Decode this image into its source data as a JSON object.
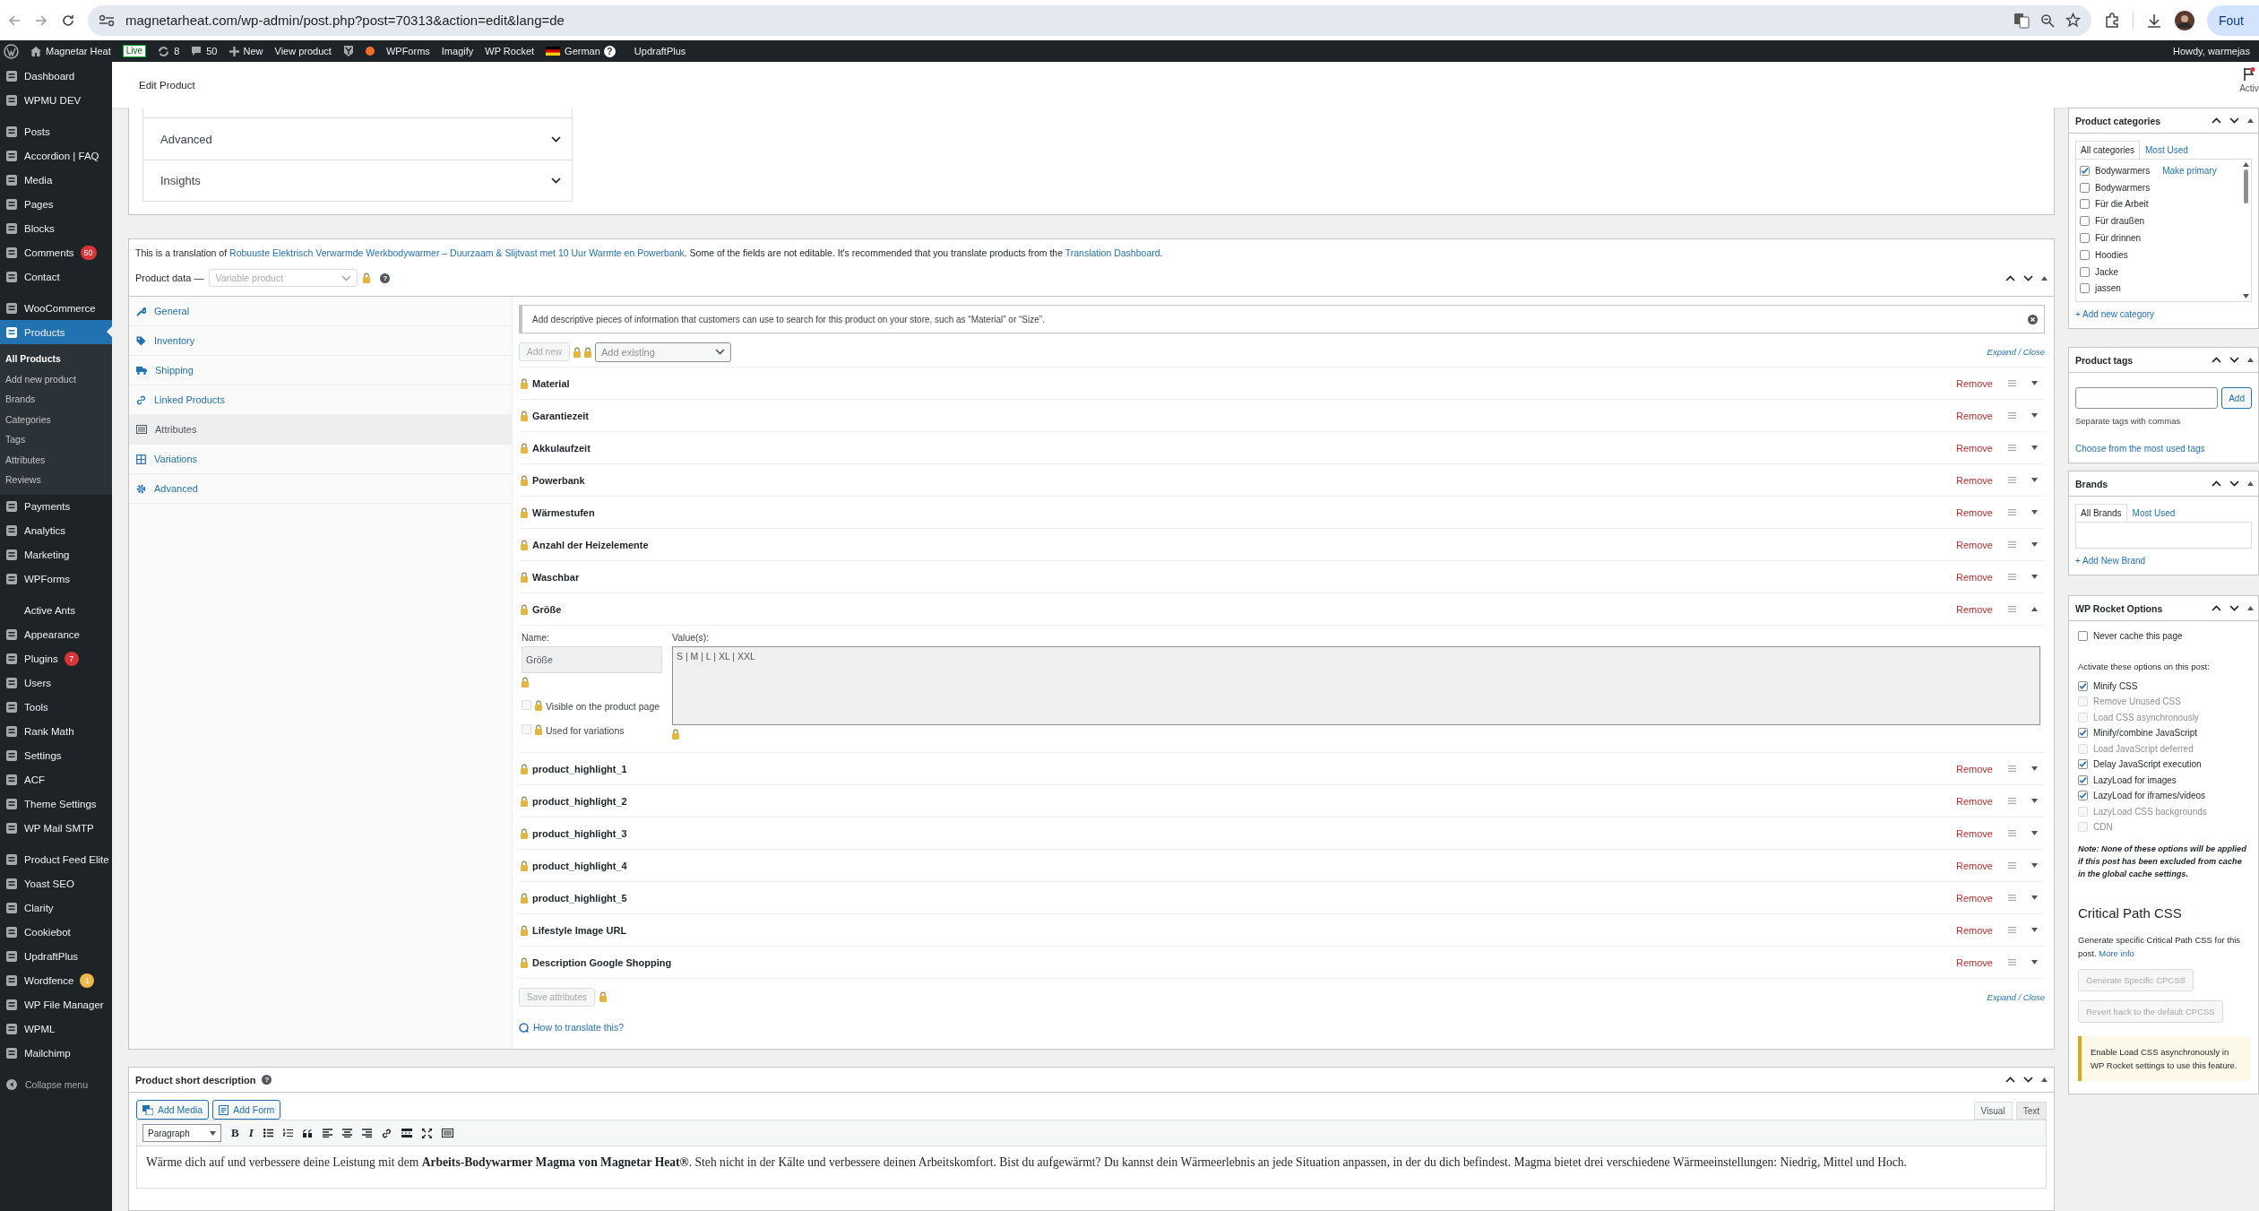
{
  "browser": {
    "url": "magnetarheat.com/wp-admin/post.php?post=70313&action=edit&lang=de",
    "profile_button": "Fout"
  },
  "admin_bar": {
    "site_name": "Magnetar Heat",
    "live_badge": "Live",
    "updates_count": "8",
    "comments_count": "50",
    "new_label": "New",
    "view_link": "View product",
    "plugin_links": [
      "WPForms",
      "Imagify",
      "WP Rocket"
    ],
    "language": "German",
    "language_help": "?",
    "updraft": "UpdraftPlus",
    "greeting": "Howdy, warmejas"
  },
  "page_header": {
    "title": "Edit Product",
    "activity": "Activ"
  },
  "sidebar": {
    "groups": [
      [
        {
          "label": "Dashboard",
          "icon": true,
          "selected": false
        },
        {
          "label": "WPMU DEV",
          "icon": true,
          "selected": false
        }
      ],
      [
        {
          "label": "Posts",
          "icon": true,
          "selected": false
        },
        {
          "label": "Accordion | FAQ",
          "icon": true,
          "selected": false
        },
        {
          "label": "Media",
          "icon": true,
          "selected": false
        },
        {
          "label": "Pages",
          "icon": true,
          "selected": false
        },
        {
          "label": "Blocks",
          "icon": true,
          "selected": false
        },
        {
          "label": "Comments",
          "icon": true,
          "selected": false,
          "badge": {
            "text": "50",
            "color": "#d63638"
          }
        },
        {
          "label": "Contact",
          "icon": true,
          "selected": false
        }
      ],
      [
        {
          "label": "WooCommerce",
          "icon": true,
          "selected": false
        },
        {
          "label": "Products",
          "icon": true,
          "selected": true,
          "children": [
            {
              "label": "All Products",
              "selected": true
            },
            {
              "label": "Add new product",
              "selected": false
            },
            {
              "label": "Brands",
              "selected": false
            },
            {
              "label": "Categories",
              "selected": false
            },
            {
              "label": "Tags",
              "selected": false
            },
            {
              "label": "Attributes",
              "selected": false
            },
            {
              "label": "Reviews",
              "selected": false
            }
          ]
        },
        {
          "label": "Payments",
          "icon": true,
          "selected": false
        },
        {
          "label": "Analytics",
          "icon": true,
          "selected": false
        },
        {
          "label": "Marketing",
          "icon": true,
          "selected": false
        },
        {
          "label": "WPForms",
          "icon": true,
          "selected": false
        }
      ],
      [
        {
          "label": "Active Ants",
          "icon": false,
          "selected": false
        },
        {
          "label": "Appearance",
          "icon": true,
          "selected": false
        },
        {
          "label": "Plugins",
          "icon": true,
          "selected": false,
          "badge": {
            "text": "7",
            "color": "#d63638"
          }
        },
        {
          "label": "Users",
          "icon": true,
          "selected": false
        },
        {
          "label": "Tools",
          "icon": true,
          "selected": false
        },
        {
          "label": "Rank Math",
          "icon": true,
          "selected": false
        },
        {
          "label": "Settings",
          "icon": true,
          "selected": false
        },
        {
          "label": "ACF",
          "icon": true,
          "selected": false
        },
        {
          "label": "Theme Settings",
          "icon": true,
          "selected": false
        },
        {
          "label": "WP Mail SMTP",
          "icon": true,
          "selected": false
        }
      ],
      [
        {
          "label": "Product Feed Elite",
          "icon": true,
          "selected": false
        },
        {
          "label": "Yoast SEO",
          "icon": true,
          "selected": false
        },
        {
          "label": "Clarity",
          "icon": true,
          "selected": false
        },
        {
          "label": "Cookiebot",
          "icon": true,
          "selected": false
        },
        {
          "label": "UpdraftPlus",
          "icon": true,
          "selected": false
        },
        {
          "label": "Wordfence",
          "icon": true,
          "selected": false,
          "badge": {
            "text": "1",
            "color": "#f0b849"
          }
        },
        {
          "label": "WP File Manager",
          "icon": true,
          "selected": false
        },
        {
          "label": "WPML",
          "icon": true,
          "selected": false
        },
        {
          "label": "Mailchimp",
          "icon": true,
          "selected": false
        }
      ]
    ],
    "collapse": "Collapse menu"
  },
  "accordion": [
    {
      "label": "Advanced",
      "expanded": false
    },
    {
      "label": "Insights",
      "expanded": false
    }
  ],
  "product_data": {
    "translation_note": {
      "before": "This is a translation of ",
      "link": "Robuuste Elektrisch Verwarmde Werkbodywarmer – Duurzaam & Slijtvast met 10 Uur Warmte en Powerbank",
      "middle": ". Some of the fields are not editable. It's recommended that you translate products from the ",
      "link2": "Translation Dashboard",
      "after": "."
    },
    "title": "Product data —",
    "product_type": "Variable product",
    "help": "?",
    "tabs": [
      {
        "label": "General",
        "selected": false
      },
      {
        "label": "Inventory",
        "selected": false
      },
      {
        "label": "Shipping",
        "selected": false
      },
      {
        "label": "Linked Products",
        "selected": false
      },
      {
        "label": "Attributes",
        "selected": true
      },
      {
        "label": "Variations",
        "selected": false
      },
      {
        "label": "Advanced",
        "selected": false
      }
    ],
    "notice": "Add descriptive pieces of information that customers can use to search for this product on your store, such as “Material” or “Size”.",
    "add_new": "Add new",
    "add_existing": "Add existing",
    "expand_close": "Expand / Close",
    "attributes": [
      {
        "name": "Material",
        "expanded": false,
        "remove": "Remove"
      },
      {
        "name": "Garantiezeit",
        "expanded": false,
        "remove": "Remove"
      },
      {
        "name": "Akkulaufzeit",
        "expanded": false,
        "remove": "Remove"
      },
      {
        "name": "Powerbank",
        "expanded": false,
        "remove": "Remove"
      },
      {
        "name": "Wärmestufen",
        "expanded": false,
        "remove": "Remove"
      },
      {
        "name": "Anzahl der Heizelemente",
        "expanded": false,
        "remove": "Remove"
      },
      {
        "name": "Waschbar",
        "expanded": false,
        "remove": "Remove"
      },
      {
        "name": "Größe",
        "expanded": true,
        "remove": "Remove",
        "name_label": "Name:",
        "name_value": "Größe",
        "values_label": "Value(s):",
        "values": "S | M | L | XL | XXL",
        "visible_label": "Visible on the product page",
        "visible": false,
        "variations_label": "Used for variations",
        "variations": false
      },
      {
        "name": "product_highlight_1",
        "expanded": false,
        "remove": "Remove"
      },
      {
        "name": "product_highlight_2",
        "expanded": false,
        "remove": "Remove"
      },
      {
        "name": "product_highlight_3",
        "expanded": false,
        "remove": "Remove"
      },
      {
        "name": "product_highlight_4",
        "expanded": false,
        "remove": "Remove"
      },
      {
        "name": "product_highlight_5",
        "expanded": false,
        "remove": "Remove"
      },
      {
        "name": "Lifestyle Image URL",
        "expanded": false,
        "remove": "Remove"
      },
      {
        "name": "Description Google Shopping",
        "expanded": false,
        "remove": "Remove"
      }
    ],
    "save": "Save attributes",
    "expand_close_bottom": "Expand / Close",
    "how_to": "How to translate this?"
  },
  "short_description": {
    "title": "Product short description",
    "help": "?",
    "add_media": "Add Media",
    "add_form": "Add Form",
    "modes": [
      {
        "label": "Visual",
        "selected": true
      },
      {
        "label": "Text",
        "selected": false
      }
    ],
    "format": "Paragraph",
    "bold": "B",
    "italic": "I",
    "content": "Wärme dich auf und verbessere deine Leistung mit dem **Arbeits-Bodywarmer Magma von Magnetar Heat®**. Steh nicht in der Kälte und verbessere deinen Arbeitskomfort. Bist du aufgewärmt? Du kannst dein Wärmeerlebnis an jede Situation anpassen, in der du dich befindest. Magma bietet drei verschiedene Wärmeeinstellungen: Niedrig, Mittel und Hoch."
  },
  "categories": {
    "title": "Product categories",
    "tabs": [
      {
        "label": "All categories",
        "selected": true
      },
      {
        "label": "Most Used",
        "selected": false
      }
    ],
    "items": [
      {
        "label": "Bodywarmers",
        "checked": true,
        "primary_link": "Make primary"
      },
      {
        "label": "Bodywarmers",
        "checked": false
      },
      {
        "label": "Für die Arbeit",
        "checked": false
      },
      {
        "label": "Für draußen",
        "checked": false
      },
      {
        "label": "Für drinnen",
        "checked": false
      },
      {
        "label": "Hoodies",
        "checked": false
      },
      {
        "label": "Jacke",
        "checked": false
      },
      {
        "label": "jassen",
        "checked": false
      }
    ],
    "add_link": "+ Add new category"
  },
  "tags": {
    "title": "Product tags",
    "add": "Add",
    "hint": "Separate tags with commas",
    "link": "Choose from the most used tags"
  },
  "brands": {
    "title": "Brands",
    "tabs": [
      {
        "label": "All Brands",
        "selected": true
      },
      {
        "label": "Most Used",
        "selected": false
      }
    ],
    "add_link": "+ Add New Brand"
  },
  "wp_rocket": {
    "title": "WP Rocket Options",
    "never_cache": {
      "label": "Never cache this page",
      "checked": false
    },
    "intro": "Activate these options on this post:",
    "options": [
      {
        "label": "Minify CSS",
        "checked": true,
        "disabled": false
      },
      {
        "label": "Remove Unused CSS",
        "checked": false,
        "disabled": true
      },
      {
        "label": "Load CSS asynchronously",
        "checked": false,
        "disabled": true
      },
      {
        "label": "Minify/combine JavaScript",
        "checked": true,
        "disabled": false
      },
      {
        "label": "Load JavaScript deferred",
        "checked": false,
        "disabled": true
      },
      {
        "label": "Delay JavaScript execution",
        "checked": true,
        "disabled": false
      },
      {
        "label": "LazyLoad for images",
        "checked": true,
        "disabled": false
      },
      {
        "label": "LazyLoad for iframes/videos",
        "checked": true,
        "disabled": false
      },
      {
        "label": "LazyLoad CSS backgrounds",
        "checked": false,
        "disabled": true
      },
      {
        "label": "CDN",
        "checked": false,
        "disabled": true
      }
    ],
    "note": "Note: None of these options will be applied if this post has been excluded from cache in the global cache settings.",
    "cpcss_title": "Critical Path CSS",
    "cpcss_text": "Generate specific Critical Path CSS for this post.",
    "more_info": "More info",
    "generate": "Generate Specific CPCSS",
    "revert": "Revert back to the default CPCSS",
    "warning": "Enable Load CSS asynchronously in WP Rocket settings to use this feature."
  }
}
